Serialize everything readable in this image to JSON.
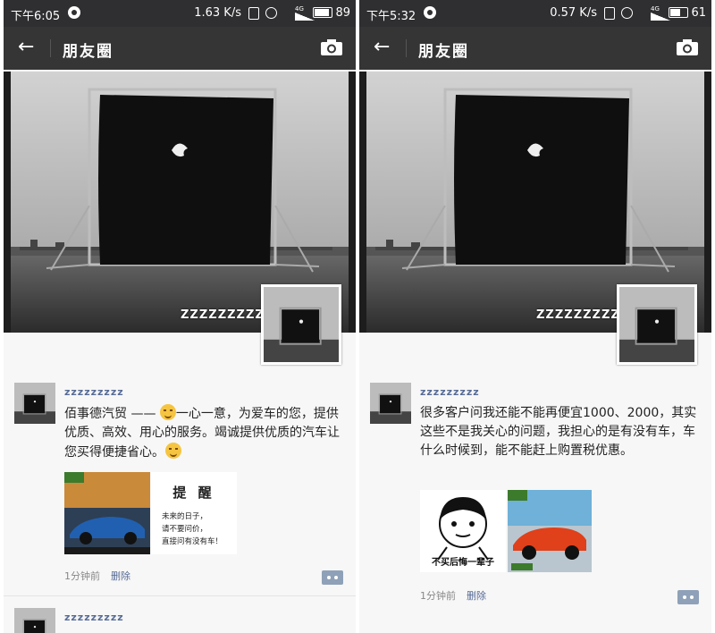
{
  "left": {
    "status": {
      "time": "下午6:05",
      "speed": "1.63 K/s",
      "network": "4G",
      "signal": "SIGNAL",
      "battery": "89",
      "battery_level": 0.89
    },
    "header": {
      "title": "朋友圈"
    },
    "cover": {
      "nickname": "ZZZZZZZZZ"
    },
    "post": {
      "name": "zzzzzzzzz",
      "text_before": "佰事德汽贸 —— ",
      "text_mid": "一心一意，为爱车的您，提供优质、高效、用心的服务。竭诚提供优质的汽车让您买得便捷省心。",
      "ad_title": "提 醒",
      "ad_line1": "未来的日子，",
      "ad_line2": "请不要问价，",
      "ad_line3": "直接问有没有车！",
      "time": "1分钟前",
      "delete": "删除"
    },
    "next_post": {
      "name": "zzzzzzzzz"
    }
  },
  "right": {
    "status": {
      "time": "下午5:32",
      "speed": "0.57 K/s",
      "network": "4G",
      "signal": "SIGNAL",
      "battery": "61",
      "battery_level": 0.61
    },
    "header": {
      "title": "朋友圈"
    },
    "cover": {
      "nickname": "ZZZZZZZZZ"
    },
    "post": {
      "name": "zzzzzzzzz",
      "text": "很多客户问我还能不能再便宜1000、2000，其实这些不是我关心的问题，我担心的是有没有车，车什么时候到，能不能赶上购置税优惠。",
      "meme_caption": "不买后悔一辈子",
      "time": "1分钟前",
      "delete": "删除"
    }
  },
  "icons": [
    "back-arrow-icon",
    "camera-icon",
    "more-icon",
    "emoji-icon"
  ],
  "colors": {
    "bar": "#353535",
    "status": "#2f2f31",
    "link": "#576b95",
    "bg": "#f7f7f7"
  }
}
